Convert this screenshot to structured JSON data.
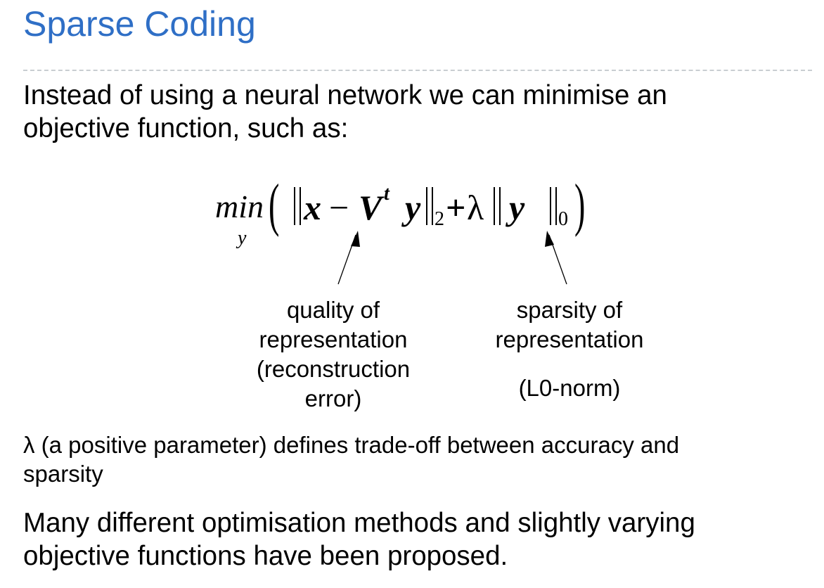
{
  "slide": {
    "title": "Sparse Coding",
    "intro_lines": [
      "Instead of using a neural network we can minimise an",
      "objective function, such as:"
    ]
  },
  "formula": {
    "operator": "min",
    "operator_subscript": "y",
    "open_paren": "(",
    "close_paren": ")",
    "x": "x",
    "minus": "−",
    "V": "V",
    "transpose": "t",
    "y1": "y",
    "norm_sub_1": "2",
    "plus": "+",
    "lambda": "λ",
    "y2": "y",
    "norm_sub_2": "0"
  },
  "annotations": {
    "quality": {
      "lines": [
        "quality of",
        "representation",
        "(reconstruction",
        "error)"
      ]
    },
    "sparsity": {
      "lines": [
        "sparsity of",
        "representation"
      ],
      "norm": "(L0-norm)"
    }
  },
  "notes": {
    "lambda_lines": [
      "λ (a positive parameter) defines trade-off between accuracy and",
      "sparsity"
    ],
    "closing_lines": [
      "Many different optimisation methods and slightly varying",
      "objective functions have been proposed."
    ]
  },
  "colors": {
    "title": "#2f6fc6",
    "rule": "#c9cdd1",
    "text": "#000000"
  }
}
